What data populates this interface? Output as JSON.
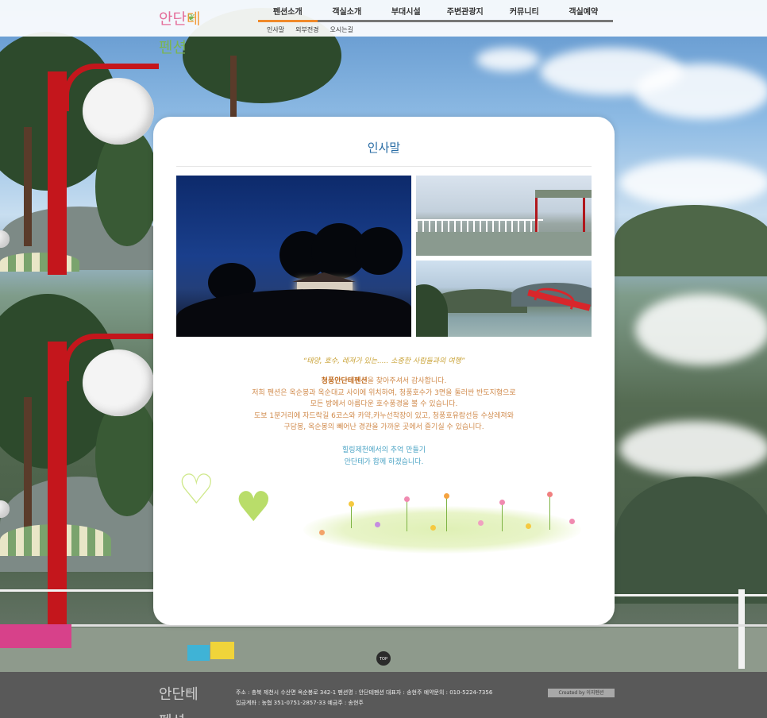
{
  "brand": {
    "logo_text_1": "안단",
    "logo_text_2": "테",
    "logo_text_3": "펜션",
    "leaf_icon": "leaf-icon"
  },
  "nav": {
    "items": [
      {
        "label": "펜션소개",
        "active": true
      },
      {
        "label": "객실소개",
        "active": false
      },
      {
        "label": "부대시설",
        "active": false
      },
      {
        "label": "주변관광지",
        "active": false
      },
      {
        "label": "커뮤니티",
        "active": false
      },
      {
        "label": "객실예약",
        "active": false
      }
    ],
    "subnav": [
      "인사말",
      "외부전경",
      "오시는길"
    ]
  },
  "content": {
    "title": "인사말",
    "quote": "“태양, 호수, 레져가 있는..... 소중한 사람들과의 여행”",
    "intro_bold": "청풍안단테펜션",
    "intro_rest": "을 찾아주셔서 감사합니다.",
    "lines": [
      "저희 펜션은 옥순봉과 옥순대교 사이에 위치하여, 청풍호수가 3면을 둘러싼 반도지형으로",
      "모든 방에서 아름다운 호수풍경을 볼 수 있습니다.",
      "도보 1분거리에 자드락길 6코스와 카약,카누선착장이 있고, 청풍호유람선등 수상레져와",
      "구담봉, 옥순봉의 빼어난 경관을 가까운 곳에서 즐기실 수 있습니다."
    ],
    "closing": [
      "힐링제천에서의 추억 만들기",
      "안단테가 함께 하겠습니다."
    ]
  },
  "top_button": "TOP",
  "footer": {
    "info_line_1": "주소 : 충북 제천시 수산면 옥순봉로 342-1 펜션명 : 안단테펜션 대표자 : 송현주 예약문의 : 010-5224-7356",
    "info_line_2": "입금계좌 : 농협 351-0751-2857-33 예금주 : 송현주",
    "created_by": "Created by 이지펜션"
  },
  "colors": {
    "accent": "#f08a2a",
    "title": "#2a6da5",
    "footer_bg": "#595959"
  }
}
